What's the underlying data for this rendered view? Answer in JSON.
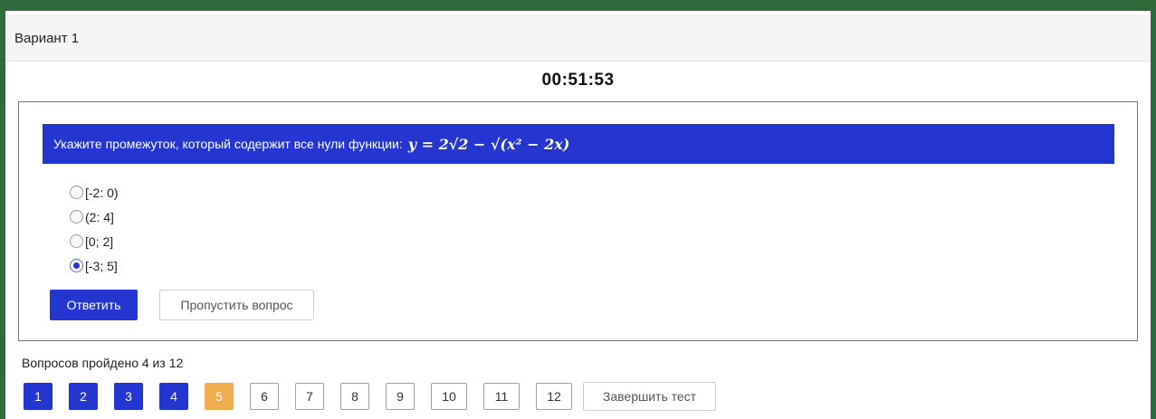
{
  "header": {
    "variant": "Вариант 1"
  },
  "timer": "00:51:53",
  "question": {
    "text": "Укажите промежуток, который содержит все нули функции:",
    "formula": "y = 2√2 − √(x² − 2x)"
  },
  "options": [
    {
      "label": "[-2: 0)",
      "selected": false
    },
    {
      "label": "(2: 4]",
      "selected": false
    },
    {
      "label": "[0; 2]",
      "selected": false
    },
    {
      "label": "[-3; 5]",
      "selected": true
    }
  ],
  "buttons": {
    "answer": "Ответить",
    "skip": "Пропустить вопрос",
    "finish": "Завершить тест"
  },
  "progress": {
    "text": "Вопросов пройдено 4 из 12",
    "completed": 4,
    "total": 12
  },
  "pages": [
    {
      "label": "1",
      "state": "done"
    },
    {
      "label": "2",
      "state": "done"
    },
    {
      "label": "3",
      "state": "done"
    },
    {
      "label": "4",
      "state": "done"
    },
    {
      "label": "5",
      "state": "current"
    },
    {
      "label": "6",
      "state": "todo"
    },
    {
      "label": "7",
      "state": "todo"
    },
    {
      "label": "8",
      "state": "todo"
    },
    {
      "label": "9",
      "state": "todo"
    },
    {
      "label": "10",
      "state": "todo"
    },
    {
      "label": "11",
      "state": "todo"
    },
    {
      "label": "12",
      "state": "todo"
    }
  ],
  "colors": {
    "primary": "#2336cf",
    "current": "#f0ad4e",
    "frame": "#2e6b3a"
  }
}
